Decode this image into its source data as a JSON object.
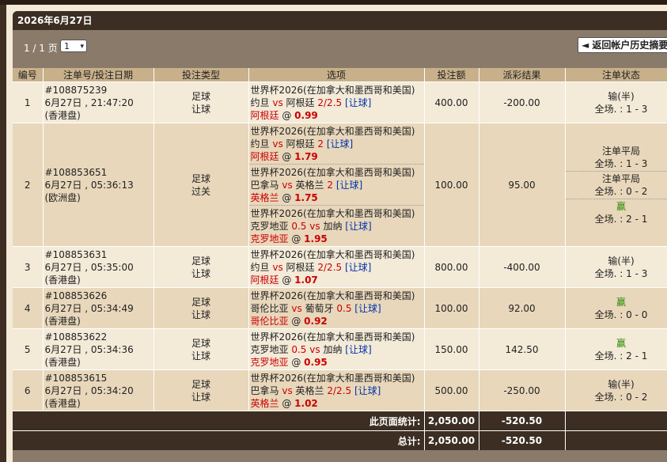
{
  "header": {
    "date_title": "2026年6月27日"
  },
  "pager": {
    "page_label": "1 / 1 页",
    "selected_page": "1",
    "back_button": "返回帐户历史摘要"
  },
  "columns": [
    "编号",
    "注单号/投注日期",
    "投注类型",
    "选项",
    "投注额",
    "派彩结果",
    "注单状态"
  ],
  "rows": [
    {
      "num": "1",
      "id": "#108875239",
      "date": "6月27日 , 21:47:20",
      "market": "(香港盘)",
      "type1": "足球",
      "type2": "让球",
      "legs": [
        {
          "league": "世界杯2026(在加拿大和墨西哥和美国)",
          "home": "约旦",
          "vs": "vs",
          "away": "阿根廷",
          "hcp": "2/2.5",
          "bet_kind": "[让球]",
          "pick": "阿根廷",
          "at": "@",
          "odds": "0.99"
        }
      ],
      "amount": "400.00",
      "result": "-200.00",
      "status": [
        {
          "state": "输(半)",
          "score": "全场. : 1 - 3"
        }
      ]
    },
    {
      "num": "2",
      "id": "#108853651",
      "date": "6月27日 , 05:36:13",
      "market": "(欧洲盘)",
      "type1": "足球",
      "type2": "过关",
      "legs": [
        {
          "league": "世界杯2026(在加拿大和墨西哥和美国)",
          "home": "约旦",
          "vs": "vs",
          "away": "阿根廷",
          "hcp": "2",
          "bet_kind": "[让球]",
          "pick": "阿根廷",
          "at": "@",
          "odds": "1.79"
        },
        {
          "league": "世界杯2026(在加拿大和墨西哥和美国)",
          "home": "巴拿马",
          "vs": "vs",
          "away": "英格兰",
          "hcp": "2",
          "bet_kind": "[让球]",
          "pick": "英格兰",
          "at": "@",
          "odds": "1.75"
        },
        {
          "league": "世界杯2026(在加拿大和墨西哥和美国)",
          "home": "克罗地亚",
          "home_hcp": "0.5",
          "vs": "vs",
          "away": "加纳",
          "hcp": "",
          "bet_kind": "[让球]",
          "pick": "克罗地亚",
          "at": "@",
          "odds": "1.95"
        }
      ],
      "amount": "100.00",
      "result": "95.00",
      "status": [
        {
          "state": "注单平局",
          "score": "全场. : 1 - 3"
        },
        {
          "state": "注单平局",
          "score": "全场. : 0 - 2"
        },
        {
          "state": "赢",
          "score": "全场. : 2 - 1"
        }
      ]
    },
    {
      "num": "3",
      "id": "#108853631",
      "date": "6月27日 , 05:35:00",
      "market": "(香港盘)",
      "type1": "足球",
      "type2": "让球",
      "legs": [
        {
          "league": "世界杯2026(在加拿大和墨西哥和美国)",
          "home": "约旦",
          "vs": "vs",
          "away": "阿根廷",
          "hcp": "2/2.5",
          "bet_kind": "[让球]",
          "pick": "阿根廷",
          "at": "@",
          "odds": "1.07"
        }
      ],
      "amount": "800.00",
      "result": "-400.00",
      "status": [
        {
          "state": "输(半)",
          "score": "全场. : 1 - 3"
        }
      ]
    },
    {
      "num": "4",
      "id": "#108853626",
      "date": "6月27日 , 05:34:49",
      "market": "(香港盘)",
      "type1": "足球",
      "type2": "让球",
      "legs": [
        {
          "league": "世界杯2026(在加拿大和墨西哥和美国)",
          "home": "哥伦比亚",
          "vs": "vs",
          "away": "葡萄牙",
          "hcp": "0.5",
          "bet_kind": "[让球]",
          "pick": "哥伦比亚",
          "at": "@",
          "odds": "0.92"
        }
      ],
      "amount": "100.00",
      "result": "92.00",
      "status": [
        {
          "state": "赢",
          "score": "全场. : 0 - 0"
        }
      ]
    },
    {
      "num": "5",
      "id": "#108853622",
      "date": "6月27日 , 05:34:36",
      "market": "(香港盘)",
      "type1": "足球",
      "type2": "让球",
      "legs": [
        {
          "league": "世界杯2026(在加拿大和墨西哥和美国)",
          "home": "克罗地亚",
          "home_hcp": "0.5",
          "vs": "vs",
          "away": "加纳",
          "hcp": "",
          "bet_kind": "[让球]",
          "pick": "克罗地亚",
          "at": "@",
          "odds": "0.95"
        }
      ],
      "amount": "150.00",
      "result": "142.50",
      "status": [
        {
          "state": "赢",
          "score": "全场. : 2 - 1"
        }
      ]
    },
    {
      "num": "6",
      "id": "#108853615",
      "date": "6月27日 , 05:34:20",
      "market": "(香港盘)",
      "type1": "足球",
      "type2": "让球",
      "legs": [
        {
          "league": "世界杯2026(在加拿大和墨西哥和美国)",
          "home": "巴拿马",
          "vs": "vs",
          "away": "英格兰",
          "hcp": "2/2.5",
          "bet_kind": "[让球]",
          "pick": "英格兰",
          "at": "@",
          "odds": "1.02"
        }
      ],
      "amount": "500.00",
      "result": "-250.00",
      "status": [
        {
          "state": "输(半)",
          "score": "全场. : 0 - 2"
        }
      ]
    }
  ],
  "totals": {
    "page_label": "此页面统计:",
    "page_amount": "2,050.00",
    "page_result": "-520.50",
    "total_label": "总计:",
    "total_amount": "2,050.00",
    "total_result": "-520.50"
  },
  "colors": {
    "title_bg": "#3c2e22",
    "header_bg": "#c8b08a",
    "row_odd": "#f3ead8",
    "row_even": "#e8d7bb",
    "loss": "#cc0000",
    "win": "#2a8a00",
    "link": "#0033aa"
  }
}
